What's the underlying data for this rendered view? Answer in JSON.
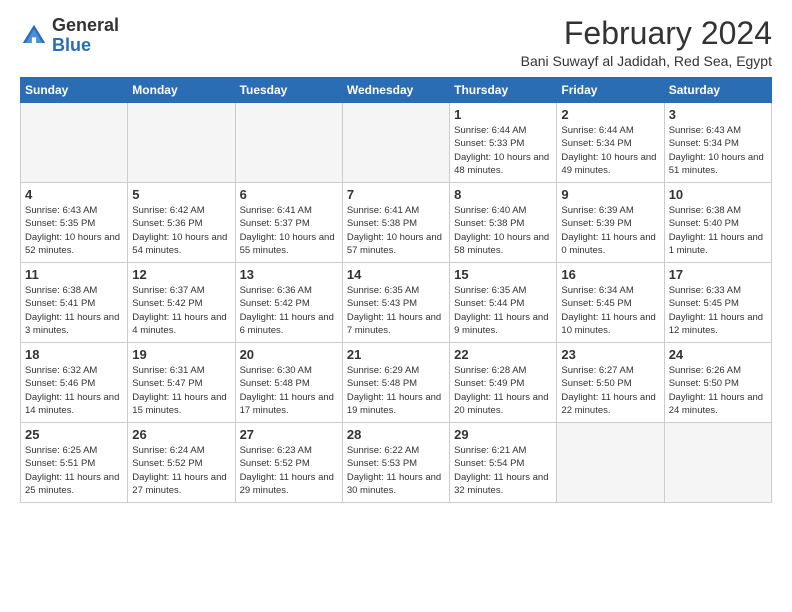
{
  "header": {
    "logo_general": "General",
    "logo_blue": "Blue",
    "month_title": "February 2024",
    "location": "Bani Suwayf al Jadidah, Red Sea, Egypt"
  },
  "weekdays": [
    "Sunday",
    "Monday",
    "Tuesday",
    "Wednesday",
    "Thursday",
    "Friday",
    "Saturday"
  ],
  "weeks": [
    [
      {
        "day": "",
        "info": ""
      },
      {
        "day": "",
        "info": ""
      },
      {
        "day": "",
        "info": ""
      },
      {
        "day": "",
        "info": ""
      },
      {
        "day": "1",
        "info": "Sunrise: 6:44 AM\nSunset: 5:33 PM\nDaylight: 10 hours\nand 48 minutes."
      },
      {
        "day": "2",
        "info": "Sunrise: 6:44 AM\nSunset: 5:34 PM\nDaylight: 10 hours\nand 49 minutes."
      },
      {
        "day": "3",
        "info": "Sunrise: 6:43 AM\nSunset: 5:34 PM\nDaylight: 10 hours\nand 51 minutes."
      }
    ],
    [
      {
        "day": "4",
        "info": "Sunrise: 6:43 AM\nSunset: 5:35 PM\nDaylight: 10 hours\nand 52 minutes."
      },
      {
        "day": "5",
        "info": "Sunrise: 6:42 AM\nSunset: 5:36 PM\nDaylight: 10 hours\nand 54 minutes."
      },
      {
        "day": "6",
        "info": "Sunrise: 6:41 AM\nSunset: 5:37 PM\nDaylight: 10 hours\nand 55 minutes."
      },
      {
        "day": "7",
        "info": "Sunrise: 6:41 AM\nSunset: 5:38 PM\nDaylight: 10 hours\nand 57 minutes."
      },
      {
        "day": "8",
        "info": "Sunrise: 6:40 AM\nSunset: 5:38 PM\nDaylight: 10 hours\nand 58 minutes."
      },
      {
        "day": "9",
        "info": "Sunrise: 6:39 AM\nSunset: 5:39 PM\nDaylight: 11 hours\nand 0 minutes."
      },
      {
        "day": "10",
        "info": "Sunrise: 6:38 AM\nSunset: 5:40 PM\nDaylight: 11 hours\nand 1 minute."
      }
    ],
    [
      {
        "day": "11",
        "info": "Sunrise: 6:38 AM\nSunset: 5:41 PM\nDaylight: 11 hours\nand 3 minutes."
      },
      {
        "day": "12",
        "info": "Sunrise: 6:37 AM\nSunset: 5:42 PM\nDaylight: 11 hours\nand 4 minutes."
      },
      {
        "day": "13",
        "info": "Sunrise: 6:36 AM\nSunset: 5:42 PM\nDaylight: 11 hours\nand 6 minutes."
      },
      {
        "day": "14",
        "info": "Sunrise: 6:35 AM\nSunset: 5:43 PM\nDaylight: 11 hours\nand 7 minutes."
      },
      {
        "day": "15",
        "info": "Sunrise: 6:35 AM\nSunset: 5:44 PM\nDaylight: 11 hours\nand 9 minutes."
      },
      {
        "day": "16",
        "info": "Sunrise: 6:34 AM\nSunset: 5:45 PM\nDaylight: 11 hours\nand 10 minutes."
      },
      {
        "day": "17",
        "info": "Sunrise: 6:33 AM\nSunset: 5:45 PM\nDaylight: 11 hours\nand 12 minutes."
      }
    ],
    [
      {
        "day": "18",
        "info": "Sunrise: 6:32 AM\nSunset: 5:46 PM\nDaylight: 11 hours\nand 14 minutes."
      },
      {
        "day": "19",
        "info": "Sunrise: 6:31 AM\nSunset: 5:47 PM\nDaylight: 11 hours\nand 15 minutes."
      },
      {
        "day": "20",
        "info": "Sunrise: 6:30 AM\nSunset: 5:48 PM\nDaylight: 11 hours\nand 17 minutes."
      },
      {
        "day": "21",
        "info": "Sunrise: 6:29 AM\nSunset: 5:48 PM\nDaylight: 11 hours\nand 19 minutes."
      },
      {
        "day": "22",
        "info": "Sunrise: 6:28 AM\nSunset: 5:49 PM\nDaylight: 11 hours\nand 20 minutes."
      },
      {
        "day": "23",
        "info": "Sunrise: 6:27 AM\nSunset: 5:50 PM\nDaylight: 11 hours\nand 22 minutes."
      },
      {
        "day": "24",
        "info": "Sunrise: 6:26 AM\nSunset: 5:50 PM\nDaylight: 11 hours\nand 24 minutes."
      }
    ],
    [
      {
        "day": "25",
        "info": "Sunrise: 6:25 AM\nSunset: 5:51 PM\nDaylight: 11 hours\nand 25 minutes."
      },
      {
        "day": "26",
        "info": "Sunrise: 6:24 AM\nSunset: 5:52 PM\nDaylight: 11 hours\nand 27 minutes."
      },
      {
        "day": "27",
        "info": "Sunrise: 6:23 AM\nSunset: 5:52 PM\nDaylight: 11 hours\nand 29 minutes."
      },
      {
        "day": "28",
        "info": "Sunrise: 6:22 AM\nSunset: 5:53 PM\nDaylight: 11 hours\nand 30 minutes."
      },
      {
        "day": "29",
        "info": "Sunrise: 6:21 AM\nSunset: 5:54 PM\nDaylight: 11 hours\nand 32 minutes."
      },
      {
        "day": "",
        "info": ""
      },
      {
        "day": "",
        "info": ""
      }
    ]
  ]
}
